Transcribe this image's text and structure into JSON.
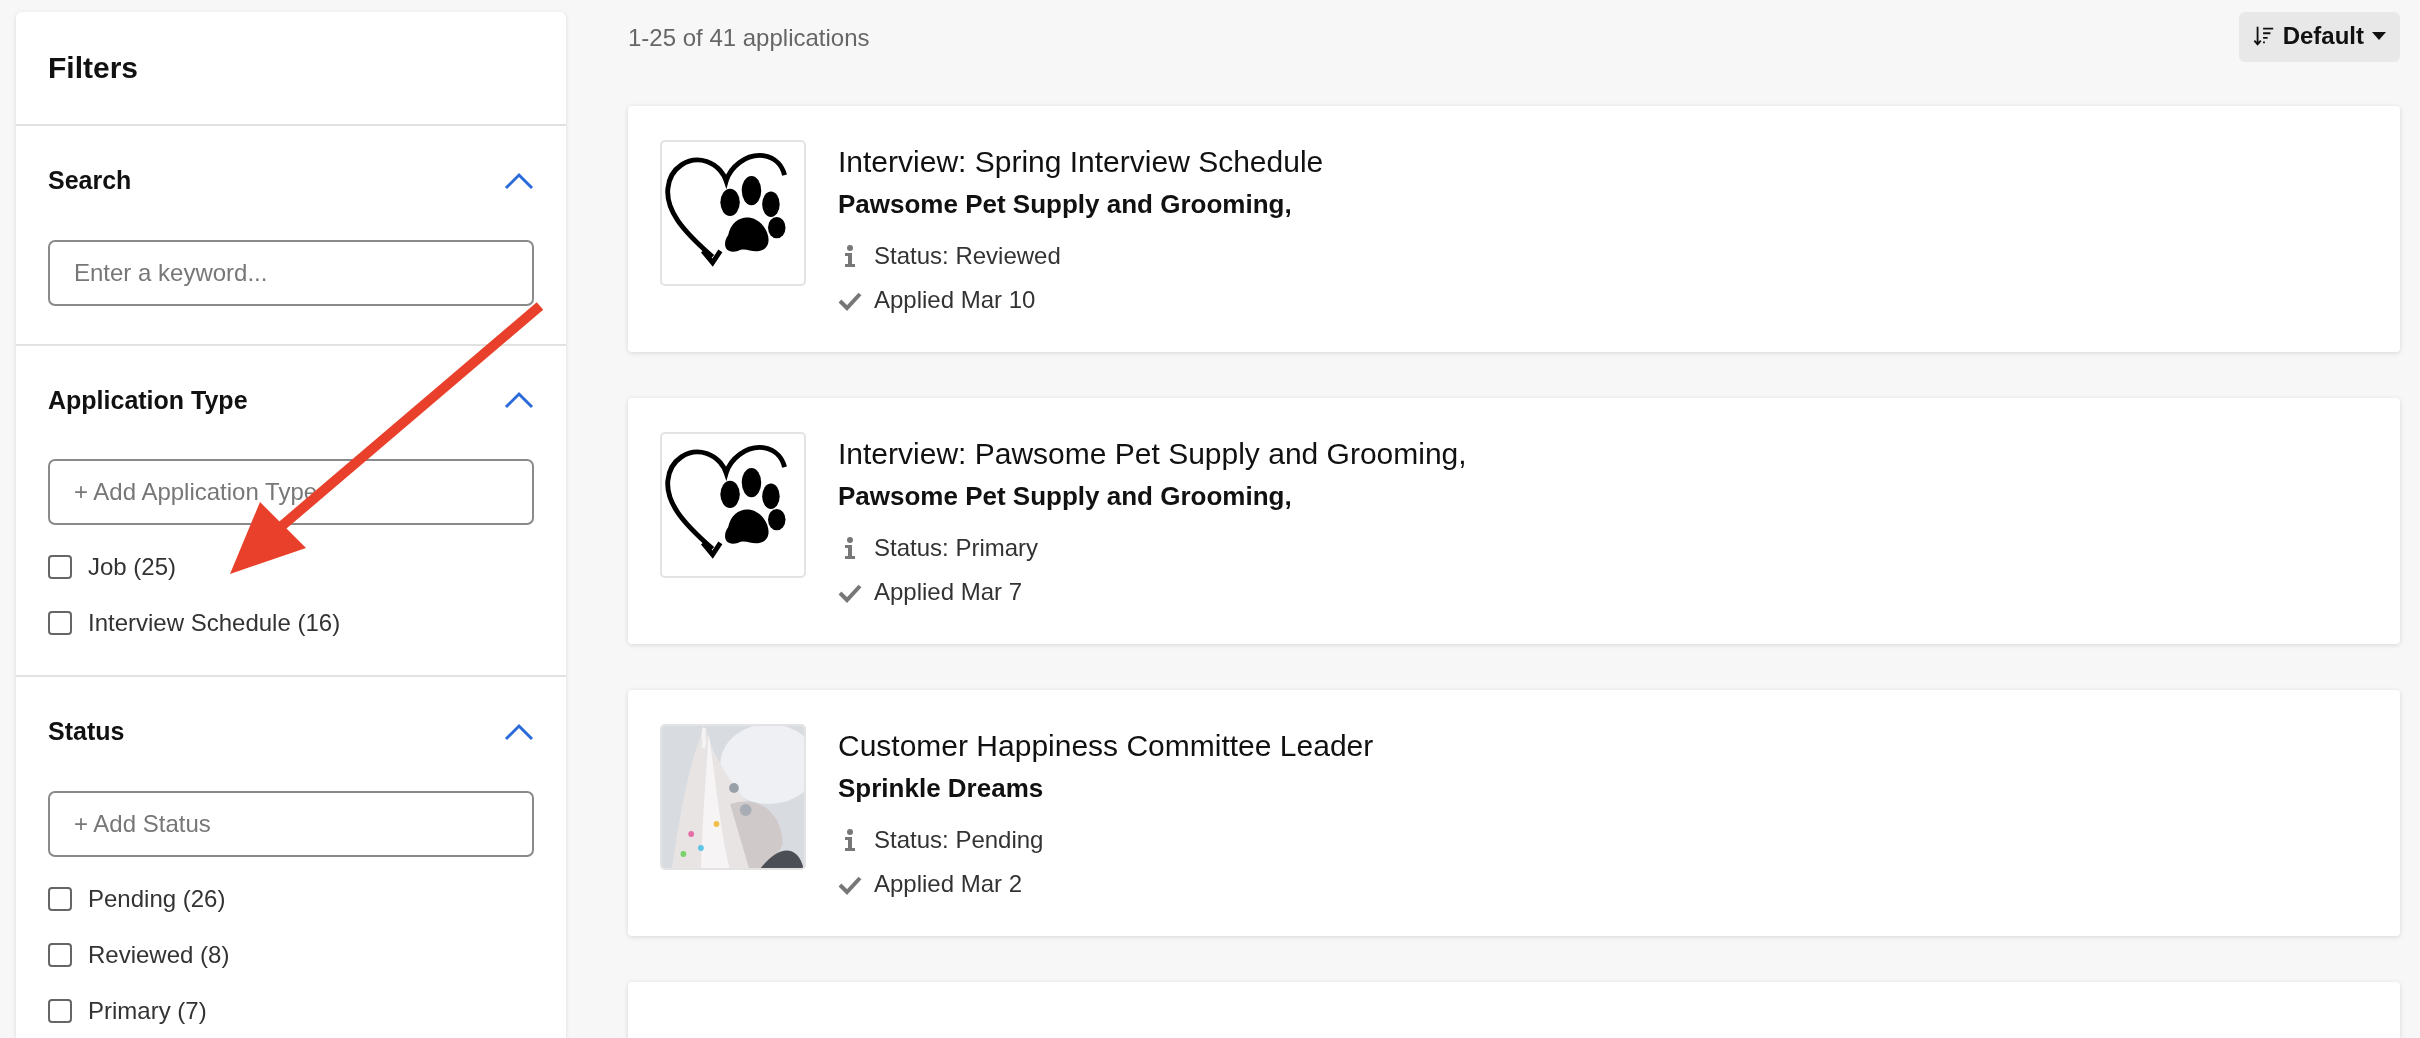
{
  "filters": {
    "title": "Filters",
    "sections": [
      {
        "kind": "search",
        "title": "Search",
        "expanded": true,
        "placeholder": "Enter a keyword..."
      },
      {
        "kind": "checklist",
        "title": "Application Type",
        "expanded": true,
        "placeholder": "+ Add Application Type",
        "options": [
          {
            "label": "Job (25)",
            "checked": false
          },
          {
            "label": "Interview Schedule (16)",
            "checked": false
          }
        ]
      },
      {
        "kind": "checklist",
        "title": "Status",
        "expanded": true,
        "placeholder": "+ Add Status",
        "options": [
          {
            "label": "Pending (26)",
            "checked": false
          },
          {
            "label": "Reviewed (8)",
            "checked": false
          },
          {
            "label": "Primary (7)",
            "checked": false
          }
        ]
      }
    ]
  },
  "results": {
    "count": "1-25 of 41 applications",
    "sort": "Default"
  },
  "applications": [
    {
      "kind": "full",
      "image": {
        "kind": "paw_logo"
      },
      "title": "Interview: Spring Interview Schedule",
      "company": "Pawsome Pet Supply and Grooming,",
      "status": "Status: Reviewed",
      "applied": "Applied Mar 10"
    },
    {
      "kind": "full",
      "image": {
        "kind": "paw_logo"
      },
      "title": "Interview: Pawsome Pet Supply and Grooming,",
      "company": "Pawsome Pet Supply and Grooming,",
      "status": "Status: Primary",
      "applied": "Applied Mar 7"
    },
    {
      "kind": "full",
      "title": "Customer Happiness Committee Leader",
      "company": "Sprinkle Dreams",
      "status": "Status: Pending",
      "applied": "Applied Mar 2"
    },
    {
      "kind": "cut_off"
    }
  ],
  "annotation": {
    "kind": "arrow"
  }
}
